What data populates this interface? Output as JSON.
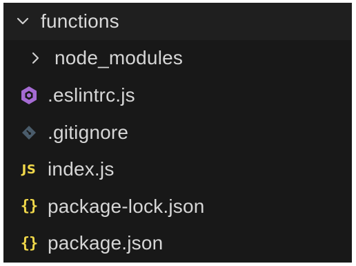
{
  "explorer": {
    "root_folder": {
      "label": "functions",
      "expanded": true
    },
    "items": [
      {
        "label": "node_modules",
        "type": "folder",
        "expanded": false,
        "icon": "chevron-right-icon"
      },
      {
        "label": ".eslintrc.js",
        "type": "file",
        "icon": "eslint-icon",
        "icon_color": "#a56bd3"
      },
      {
        "label": ".gitignore",
        "type": "file",
        "icon": "git-icon",
        "icon_color": "#4a5c6b"
      },
      {
        "label": "index.js",
        "type": "file",
        "icon": "javascript-icon",
        "icon_text": "JS",
        "icon_color": "#f0d84a"
      },
      {
        "label": "package-lock.json",
        "type": "file",
        "icon": "json-icon",
        "icon_text": "{}",
        "icon_color": "#f0d84a"
      },
      {
        "label": "package.json",
        "type": "file",
        "icon": "json-icon",
        "icon_text": "{}",
        "icon_color": "#f0d84a"
      }
    ]
  }
}
